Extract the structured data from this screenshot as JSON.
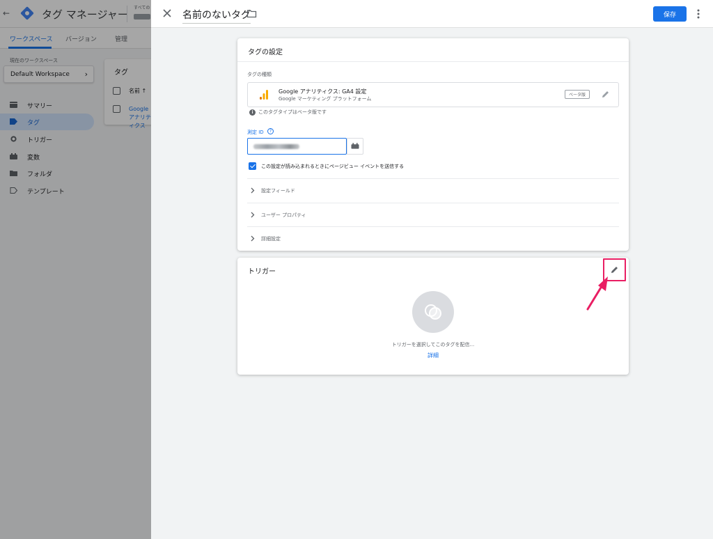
{
  "background_app": {
    "back_label": "←",
    "title": "タグ マネージャー",
    "account_label": "すべての",
    "tabs": [
      "ワークスペース",
      "バージョン",
      "管理"
    ],
    "workspace_label": "現在のワークスペース",
    "workspace_name": "Default Workspace",
    "nav": [
      {
        "label": "サマリー",
        "icon": "summary-icon"
      },
      {
        "label": "タグ",
        "icon": "tag-icon",
        "active": true
      },
      {
        "label": "トリガー",
        "icon": "trigger-icon"
      },
      {
        "label": "変数",
        "icon": "variable-icon"
      },
      {
        "label": "フォルダ",
        "icon": "folder-icon"
      },
      {
        "label": "テンプレート",
        "icon": "template-icon"
      }
    ],
    "card": {
      "title": "タグ",
      "column_header": "名前 ↑",
      "row_link": "Google アナリティクス"
    }
  },
  "editor": {
    "tag_name": "名前のないタグ",
    "save_label": "保存",
    "config": {
      "title": "タグの設定",
      "type_label": "タグの種類",
      "type_name": "Google アナリティクス: GA4 設定",
      "type_subtitle": "Google マーケティング プラットフォーム",
      "beta_badge": "ベータ版",
      "beta_note": "このタグタイプはベータ版です",
      "measurement_id_label": "測定 ID",
      "measurement_id_value": "",
      "checkbox_label": "この設定が読み込まれるときにページビュー イベントを送信する",
      "checkbox_checked": true,
      "sections": [
        "設定フィールド",
        "ユーザー プロパティ",
        "詳細設定"
      ]
    },
    "trigger": {
      "title": "トリガー",
      "empty_text": "トリガーを選択してこのタグを配信...",
      "learn_more": "詳細"
    }
  },
  "colors": {
    "primary": "#1a73e8",
    "highlight": "#e91e63",
    "ga_orange": "#f9ab00",
    "ga_dark_orange": "#e37400"
  }
}
